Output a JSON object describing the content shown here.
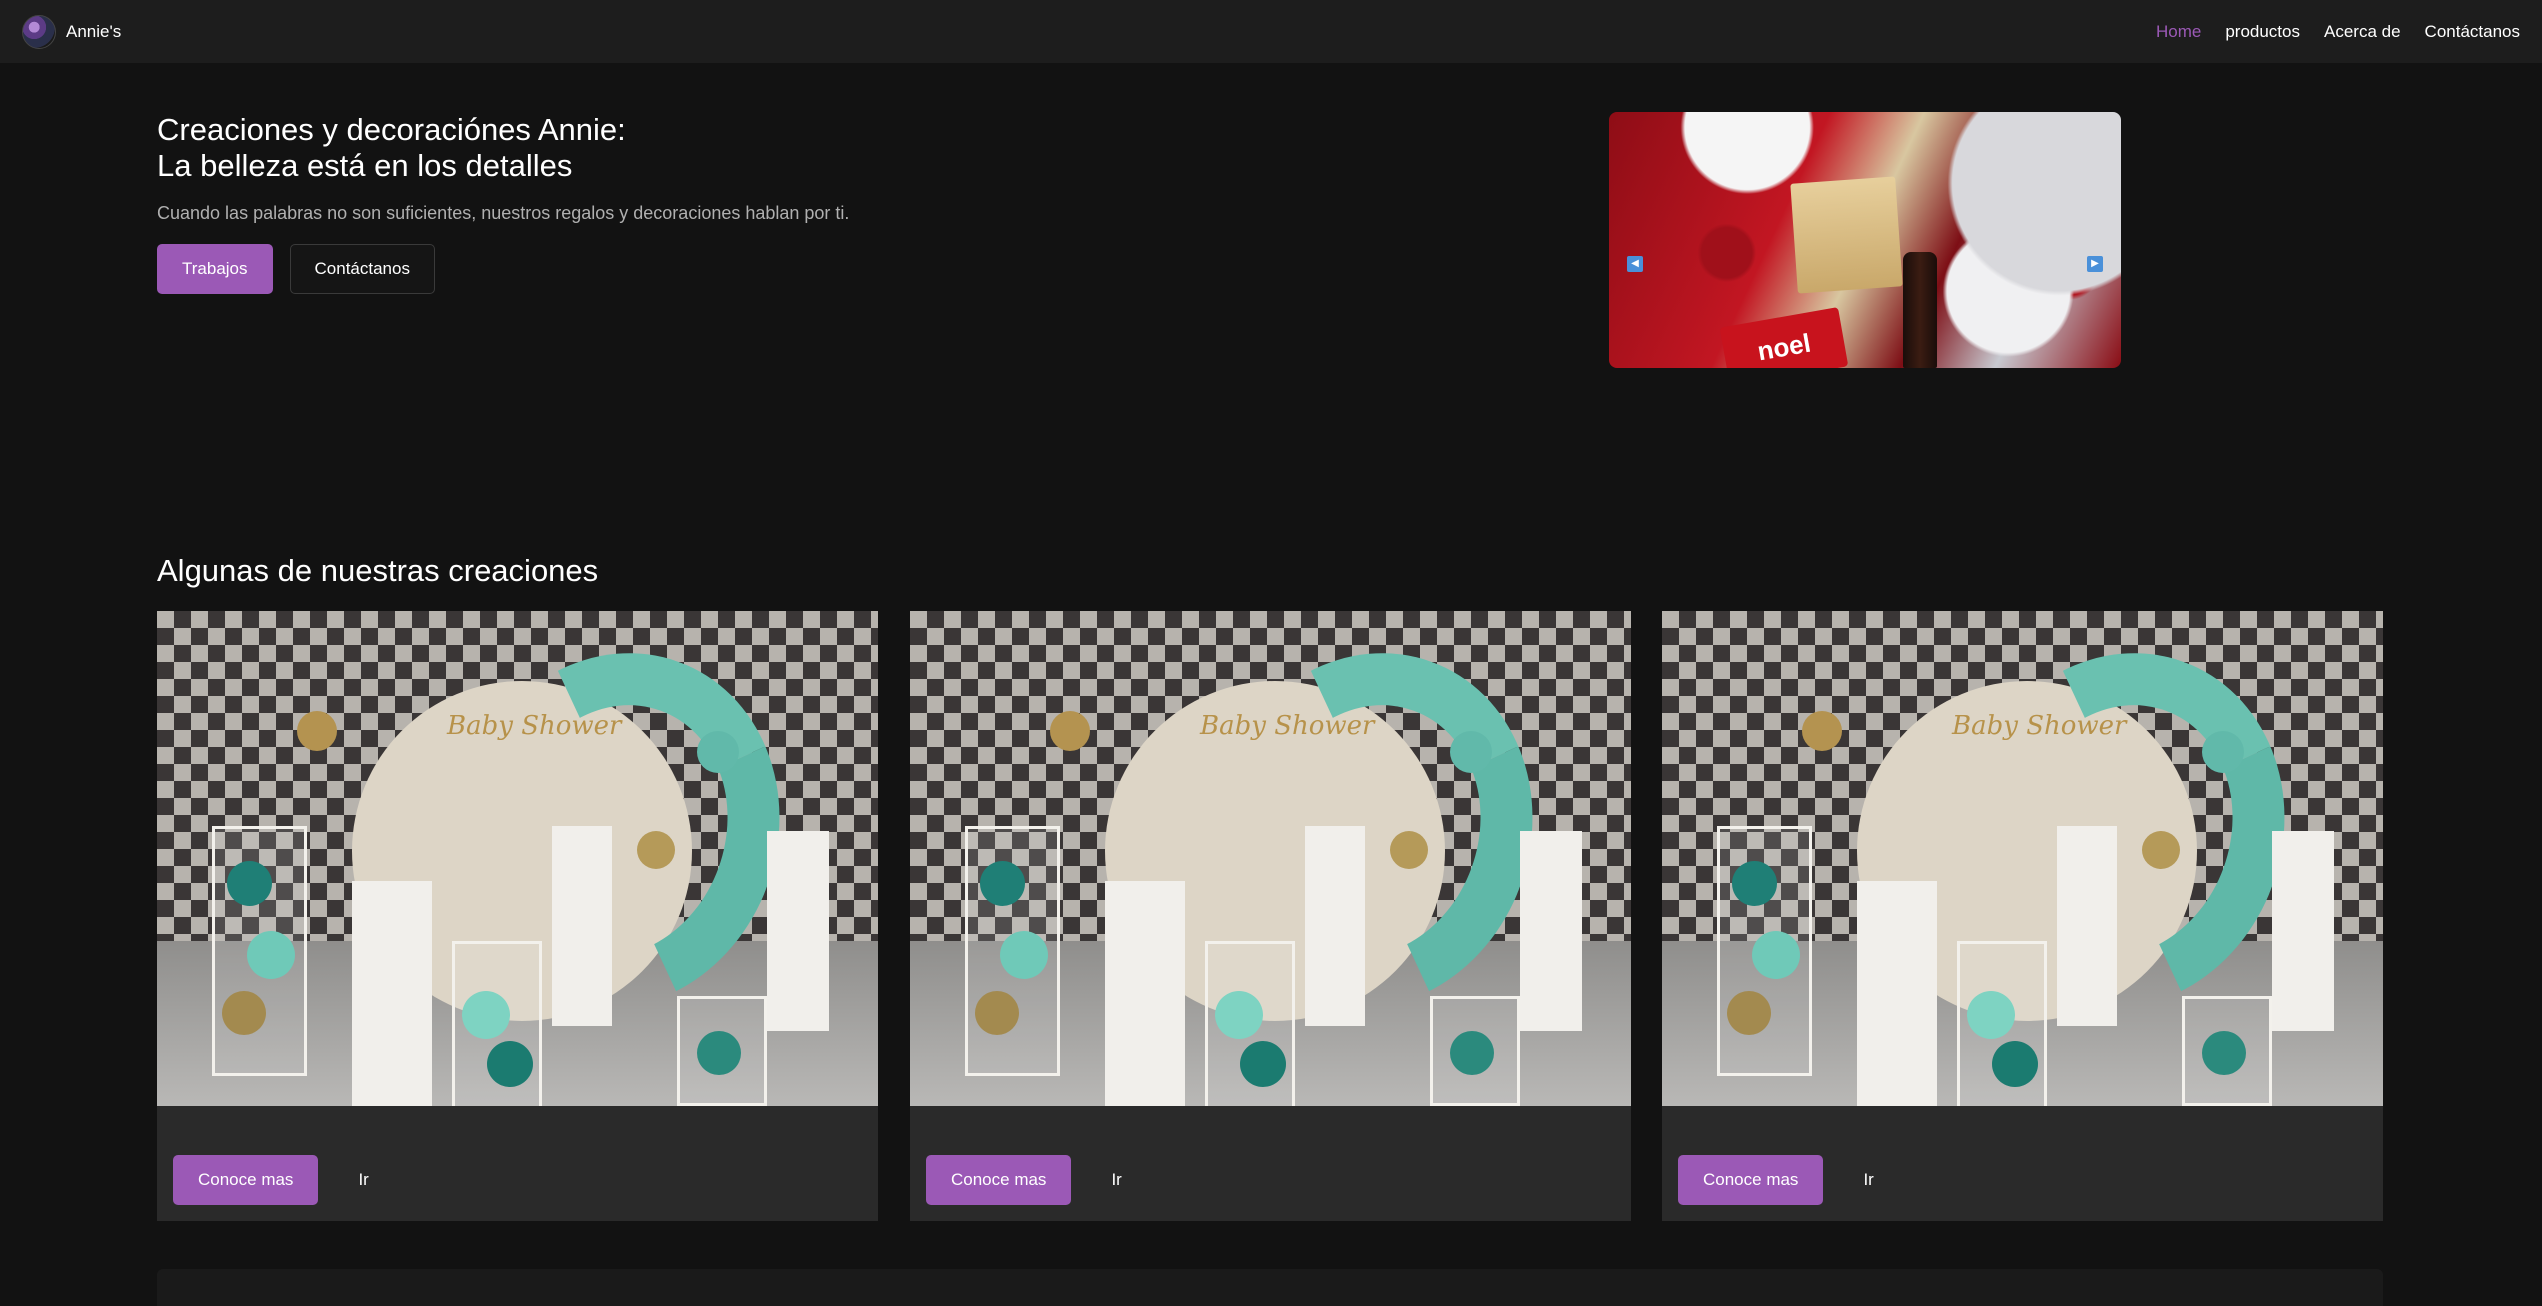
{
  "navbar": {
    "brand": "Annie's",
    "links": [
      {
        "label": "Home",
        "active": true
      },
      {
        "label": "productos",
        "active": false
      },
      {
        "label": "Acerca de",
        "active": false
      },
      {
        "label": "Contáctanos",
        "active": false
      }
    ]
  },
  "hero": {
    "title_line1": "Creaciones y decoraciónes Annie:",
    "title_line2": "La belleza está en los detalles",
    "subtitle": "Cuando las palabras no son suficientes, nuestros regalos y decoraciones hablan por ti.",
    "primary_button": "Trabajos",
    "secondary_button": "Contáctanos"
  },
  "carousel": {
    "image_text": "noel",
    "prev_icon": "◀",
    "next_icon": "▶"
  },
  "creations": {
    "title": "Algunas de nuestras creaciones",
    "image_text": "Baby Shower",
    "cards": [
      {
        "primary": "Conoce mas",
        "secondary": "Ir"
      },
      {
        "primary": "Conoce mas",
        "secondary": "Ir"
      },
      {
        "primary": "Conoce mas",
        "secondary": "Ir"
      }
    ]
  },
  "colors": {
    "accent": "#9b59b6",
    "background": "#121212",
    "navbar": "#1d1d1d",
    "card": "#2a2a2a"
  }
}
